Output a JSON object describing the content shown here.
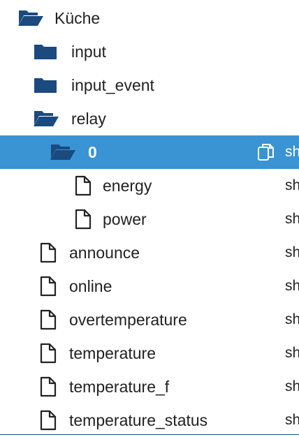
{
  "colors": {
    "selection": "#3a93d3",
    "folder": "#1b4a7e",
    "text": "#222222"
  },
  "tree": [
    {
      "label": "Küche",
      "icon": "folder-open-icon",
      "value": ""
    },
    {
      "label": "input",
      "icon": "folder-icon",
      "value": ""
    },
    {
      "label": "input_event",
      "icon": "folder-icon",
      "value": ""
    },
    {
      "label": "relay",
      "icon": "folder-open-icon",
      "value": ""
    },
    {
      "label": "0",
      "icon": "folder-open-icon",
      "value": "sh",
      "selected": true,
      "copy_icon": "copy-icon"
    },
    {
      "label": "energy",
      "icon": "file-icon",
      "value": "sh"
    },
    {
      "label": "power",
      "icon": "file-icon",
      "value": "sh"
    },
    {
      "label": "announce",
      "icon": "file-icon",
      "value": "sh"
    },
    {
      "label": "online",
      "icon": "file-icon",
      "value": "sh"
    },
    {
      "label": "overtemperature",
      "icon": "file-icon",
      "value": "sh"
    },
    {
      "label": "temperature",
      "icon": "file-icon",
      "value": "sh"
    },
    {
      "label": "temperature_f",
      "icon": "file-icon",
      "value": "sh"
    },
    {
      "label": "temperature_status",
      "icon": "file-icon",
      "value": "sh"
    }
  ]
}
